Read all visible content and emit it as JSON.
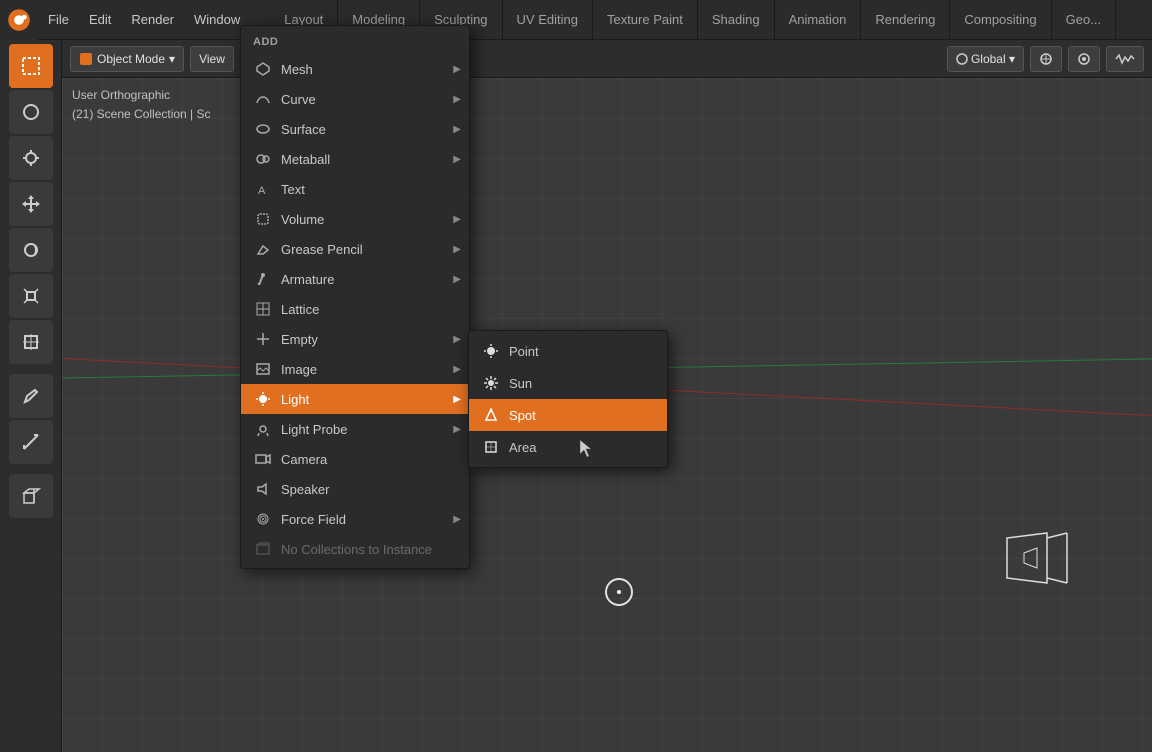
{
  "topBar": {
    "menuItems": [
      "File",
      "Edit",
      "Render",
      "Window"
    ],
    "workspaceTabs": [
      {
        "label": "Layout",
        "active": false
      },
      {
        "label": "Modeling",
        "active": false
      },
      {
        "label": "Sculpting",
        "active": false
      },
      {
        "label": "UV Editing",
        "active": false
      },
      {
        "label": "Texture Paint",
        "active": false
      },
      {
        "label": "Shading",
        "active": false
      },
      {
        "label": "Animation",
        "active": false
      },
      {
        "label": "Rendering",
        "active": false
      },
      {
        "label": "Compositing",
        "active": false
      },
      {
        "label": "Geo...",
        "active": false
      }
    ]
  },
  "headerBar": {
    "mode": "Object Mode",
    "view": "View",
    "transform": "Global",
    "icons": [
      "snap-magnet",
      "transform-pivot",
      "proportional-edit",
      "waveform"
    ]
  },
  "viewport": {
    "info_line1": "User Orthographic",
    "info_line2": "(21) Scene Collection | Sc"
  },
  "addMenu": {
    "title": "Add",
    "items": [
      {
        "label": "Mesh",
        "icon": "mesh",
        "hasSubmenu": true,
        "highlighted": false,
        "disabled": false
      },
      {
        "label": "Curve",
        "icon": "curve",
        "hasSubmenu": true,
        "highlighted": false,
        "disabled": false
      },
      {
        "label": "Surface",
        "icon": "surface",
        "hasSubmenu": true,
        "highlighted": false,
        "disabled": false
      },
      {
        "label": "Metaball",
        "icon": "metaball",
        "hasSubmenu": true,
        "highlighted": false,
        "disabled": false
      },
      {
        "label": "Text",
        "icon": "text",
        "hasSubmenu": false,
        "highlighted": false,
        "disabled": false
      },
      {
        "label": "Volume",
        "icon": "volume",
        "hasSubmenu": true,
        "highlighted": false,
        "disabled": false
      },
      {
        "label": "Grease Pencil",
        "icon": "grease-pencil",
        "hasSubmenu": true,
        "highlighted": false,
        "disabled": false
      },
      {
        "label": "Armature",
        "icon": "armature",
        "hasSubmenu": true,
        "highlighted": false,
        "disabled": false
      },
      {
        "label": "Lattice",
        "icon": "lattice",
        "hasSubmenu": false,
        "highlighted": false,
        "disabled": false
      },
      {
        "label": "Empty",
        "icon": "empty",
        "hasSubmenu": true,
        "highlighted": false,
        "disabled": false
      },
      {
        "label": "Image",
        "icon": "image",
        "hasSubmenu": true,
        "highlighted": false,
        "disabled": false
      },
      {
        "label": "Light",
        "icon": "light",
        "hasSubmenu": true,
        "highlighted": true,
        "disabled": false
      },
      {
        "label": "Light Probe",
        "icon": "light-probe",
        "hasSubmenu": true,
        "highlighted": false,
        "disabled": false
      },
      {
        "label": "Camera",
        "icon": "camera",
        "hasSubmenu": false,
        "highlighted": false,
        "disabled": false
      },
      {
        "label": "Speaker",
        "icon": "speaker",
        "hasSubmenu": false,
        "highlighted": false,
        "disabled": false
      },
      {
        "label": "Force Field",
        "icon": "force-field",
        "hasSubmenu": true,
        "highlighted": false,
        "disabled": false
      },
      {
        "label": "No Collections to Instance",
        "icon": "collection",
        "hasSubmenu": false,
        "highlighted": false,
        "disabled": true
      }
    ]
  },
  "lightSubmenu": {
    "items": [
      {
        "label": "Point",
        "highlighted": false
      },
      {
        "label": "Sun",
        "highlighted": false
      },
      {
        "label": "Spot",
        "highlighted": true
      },
      {
        "label": "Area",
        "highlighted": false
      }
    ]
  },
  "colors": {
    "accent": "#e07020",
    "highlighted_bg": "#e07020",
    "menu_bg": "#2b2b2b",
    "viewport_bg": "#3a3a3a"
  }
}
